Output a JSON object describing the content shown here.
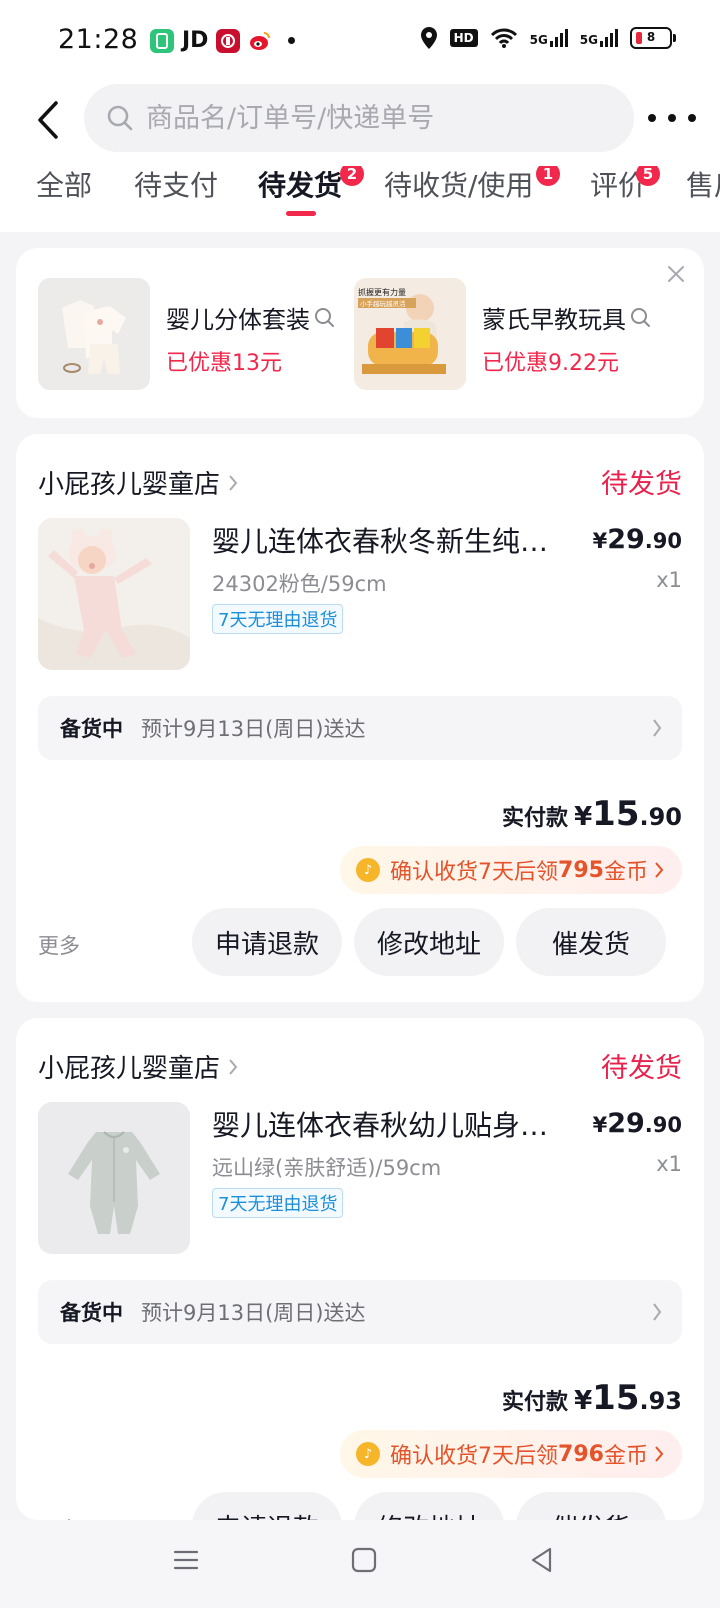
{
  "status_bar": {
    "time": "21:28",
    "apps": [
      "green-app-icon",
      "JD",
      "red-app-icon",
      "weibo-icon"
    ],
    "hd": "HD",
    "net1": "5G",
    "net2": "5G",
    "battery": "8",
    "battery_color": "#e62a3c"
  },
  "header": {
    "search_placeholder": "商品名/订单号/快递单号"
  },
  "tabs": [
    {
      "label": "全部"
    },
    {
      "label": "待支付"
    },
    {
      "label": "待发货",
      "badge": "2",
      "active": true
    },
    {
      "label": "待收货/使用",
      "badge": "1"
    },
    {
      "label": "评价",
      "badge": "5"
    },
    {
      "label": "售后"
    }
  ],
  "recommend": [
    {
      "name": "婴儿分体套装",
      "save": "已优惠13元"
    },
    {
      "name": "蒙氏早教玩具",
      "save": "已优惠9.22元",
      "img_caption": "抓握更有力量",
      "img_caption2": "小手越玩越灵活"
    }
  ],
  "orders": [
    {
      "shop": "小屁孩儿婴童店",
      "status": "待发货",
      "title": "婴儿连体衣春秋冬新生纯棉睡衣",
      "price_symbol": "¥",
      "price_int": "29",
      "price_dec": ".90",
      "spec": "24302粉色/59cm",
      "qty": "x1",
      "tag": "7天无理由退货",
      "ship_label": "备货中",
      "ship_eta": "预计9月13日(周日)送达",
      "paid_label": "实付款",
      "paid_symbol": "¥",
      "paid_int": "15",
      "paid_dec": ".90",
      "coin_pre": "确认收货7天后领",
      "coin_num": "795",
      "coin_post": "金币",
      "more": "更多",
      "buttons": [
        "申请退款",
        "修改地址",
        "催发货"
      ]
    },
    {
      "shop": "小屁孩儿婴童店",
      "status": "待发货",
      "title": "婴儿连体衣春秋幼儿贴身长袖哈衣",
      "price_symbol": "¥",
      "price_int": "29",
      "price_dec": ".90",
      "spec": "远山绿(亲肤舒适)/59cm",
      "qty": "x1",
      "tag": "7天无理由退货",
      "ship_label": "备货中",
      "ship_eta": "预计9月13日(周日)送达",
      "paid_label": "实付款",
      "paid_symbol": "¥",
      "paid_int": "15",
      "paid_dec": ".93",
      "coin_pre": "确认收货7天后领",
      "coin_num": "796",
      "coin_post": "金币",
      "more": "更多",
      "buttons": [
        "申请退款",
        "修改地址",
        "催发货"
      ]
    }
  ],
  "colors": {
    "accent": "#f2274c",
    "status": "#e8224c",
    "coin": "#e4532a",
    "tag": "#1d8fd8"
  }
}
